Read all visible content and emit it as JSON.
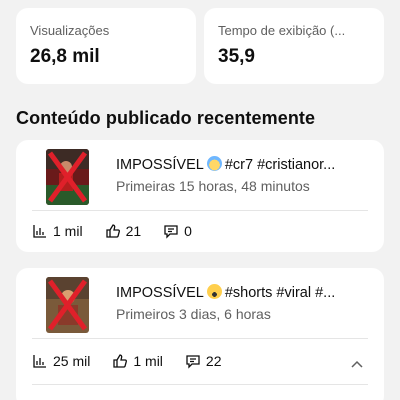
{
  "stats": {
    "views": {
      "label": "Visualizações",
      "value": "26,8 mil"
    },
    "watch_time": {
      "label": "Tempo de exibição (...",
      "value": "35,9"
    }
  },
  "section_title": "Conteúdo publicado recentemente",
  "videos": [
    {
      "title_before": "IMPOSSÍVEL",
      "title_after": "#cr7 #cristianor...",
      "meta": "Primeiras 15 horas, 48 minutos",
      "views": "1 mil",
      "likes": "21",
      "comments": "0"
    },
    {
      "title_before": "IMPOSSÍVEL",
      "title_after": "#shorts #viral #...",
      "meta": "Primeiros 3 dias, 6 horas",
      "views": "25 mil",
      "likes": "1 mil",
      "comments": "22"
    }
  ],
  "colors": {
    "background": "#f2f2f2",
    "card": "#ffffff",
    "cross": "#e0202a",
    "secondary_text": "#5f5f5f"
  },
  "icons": [
    "bar-chart-icon",
    "thumbs-up-icon",
    "comment-icon",
    "chevron-up-icon",
    "cold-face-emoji",
    "scream-face-emoji"
  ]
}
